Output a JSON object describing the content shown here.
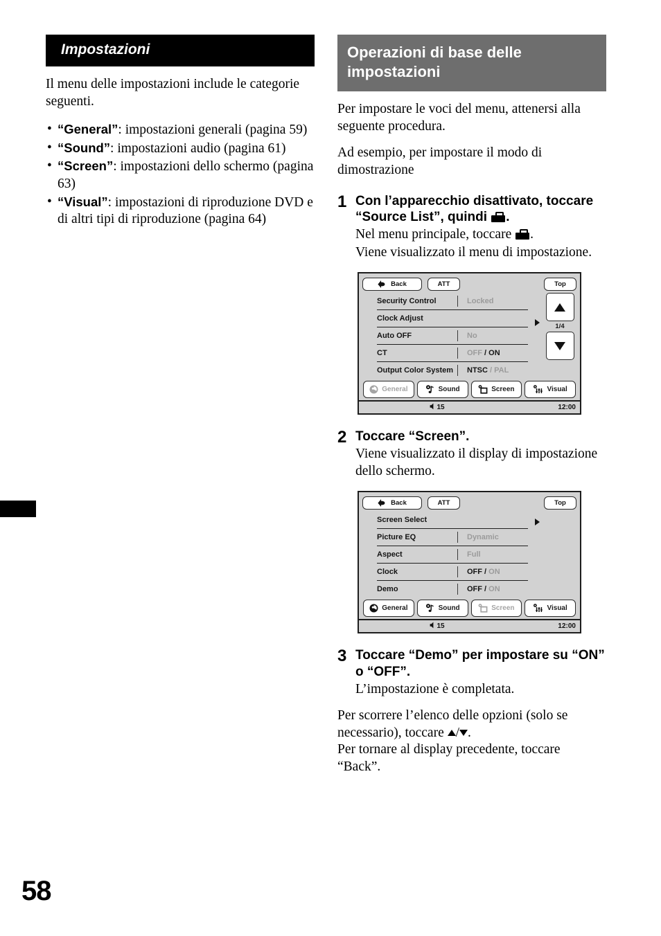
{
  "page": {
    "number": "58"
  },
  "left_column": {
    "banner_title": "Impostazioni",
    "intro": "Il menu delle impostazioni include le categorie seguenti.",
    "bullets": [
      {
        "keyword": "“General”",
        "text": ": impostazioni generali (pagina 59)"
      },
      {
        "keyword": "“Sound”",
        "text": ": impostazioni audio (pagina 61)"
      },
      {
        "keyword": "“Screen”",
        "text": ": impostazioni dello schermo (pagina 63)"
      },
      {
        "keyword": "“Visual”",
        "text": ": impostazioni di riproduzione DVD e di altri tipi di riproduzione (pagina 64)"
      }
    ]
  },
  "right_column": {
    "banner_title": "Operazioni di base delle impostazioni",
    "intro1": "Per impostare le voci del menu, attenersi alla seguente procedura.",
    "intro2": "Ad esempio, per impostare il modo di dimostrazione",
    "steps": [
      {
        "number": "1",
        "title_a": "Con l’apparecchio disattivato, toccare “Source List”, quindi",
        "title_b": ".",
        "sub_a": "Nel menu principale, toccare",
        "sub_b": ".",
        "sub2": "Viene visualizzato il menu di impostazione."
      },
      {
        "number": "2",
        "title": "Toccare “Screen”.",
        "sub": "Viene visualizzato il display di impostazione dello schermo."
      },
      {
        "number": "3",
        "title": "Toccare “Demo” per impostare su “ON” o “OFF”.",
        "sub": "L’impostazione è completata."
      }
    ],
    "closing_a": "Per scorrere l’elenco delle opzioni (solo se necessario), toccare",
    "closing_slash": "/",
    "closing_b": ".",
    "closing2": "Per tornare al display precedente, toccare “Back”."
  },
  "device_general": {
    "topbar": {
      "back_label": "Back",
      "att_label": "ATT",
      "top_label": "Top",
      "back_icon": "back-arrow-icon"
    },
    "rows": [
      {
        "label": "Security Control",
        "value": "Locked",
        "value_state": "dim",
        "has_divider": true,
        "has_arrow": false
      },
      {
        "label": "Clock Adjust",
        "value": "",
        "value_state": "dim",
        "has_divider": false,
        "has_arrow": true
      },
      {
        "label": "Auto OFF",
        "value": "No",
        "value_state": "dim",
        "has_divider": true,
        "has_arrow": false
      },
      {
        "label": "CT",
        "value_off": "OFF",
        "value_sep": " / ",
        "value_on": "ON",
        "off_state": "dim",
        "on_state": "on",
        "has_divider": true,
        "has_arrow": false
      },
      {
        "label": "Output Color System",
        "value_off": "NTSC",
        "value_sep": " / ",
        "value_on": "PAL",
        "off_state": "on",
        "on_state": "dim",
        "has_divider": true,
        "has_arrow": false
      }
    ],
    "nav": {
      "up_icon": "triangle-up-icon",
      "page_indicator": "1/4",
      "down_icon": "triangle-down-icon"
    },
    "tabs": [
      {
        "label": "General",
        "icon": "general-gear-icon",
        "active": false
      },
      {
        "label": "Sound",
        "icon": "sound-note-icon",
        "active": true
      },
      {
        "label": "Screen",
        "icon": "screen-monitor-icon",
        "active": true
      },
      {
        "label": "Visual",
        "icon": "visual-sliders-icon",
        "active": true
      }
    ],
    "status": {
      "volume": "15",
      "volume_icon": "speaker-icon",
      "clock": "12:00"
    }
  },
  "device_screen": {
    "topbar": {
      "back_label": "Back",
      "att_label": "ATT",
      "top_label": "Top",
      "back_icon": "back-arrow-icon"
    },
    "rows": [
      {
        "label": "Screen Select",
        "value": "",
        "value_state": "dim",
        "has_divider": false,
        "has_arrow": true
      },
      {
        "label": "Picture EQ",
        "value": "Dynamic",
        "value_state": "dim",
        "has_divider": true,
        "has_arrow": false
      },
      {
        "label": "Aspect",
        "value": "Full",
        "value_state": "dim",
        "has_divider": true,
        "has_arrow": false
      },
      {
        "label": "Clock",
        "value_off": "OFF",
        "value_sep": " / ",
        "value_on": "ON",
        "off_state": "on",
        "on_state": "dim",
        "has_divider": true,
        "has_arrow": false
      },
      {
        "label": "Demo",
        "value_off": "OFF",
        "value_sep": " / ",
        "value_on": "ON",
        "off_state": "on",
        "on_state": "dim",
        "has_divider": true,
        "has_arrow": false
      }
    ],
    "tabs": [
      {
        "label": "General",
        "icon": "general-gear-icon",
        "active": true
      },
      {
        "label": "Sound",
        "icon": "sound-note-icon",
        "active": true
      },
      {
        "label": "Screen",
        "icon": "screen-monitor-icon",
        "active": false
      },
      {
        "label": "Visual",
        "icon": "visual-sliders-icon",
        "active": true
      }
    ],
    "status": {
      "volume": "15",
      "volume_icon": "speaker-icon",
      "clock": "12:00"
    }
  },
  "colors": {
    "banner_black": "#000000",
    "banner_gray": "#6e6e6e",
    "device_bg": "#d2d2d2",
    "device_border": "#1d1d1d",
    "value_dim": "#9b9b9b",
    "value_on": "#141414"
  }
}
